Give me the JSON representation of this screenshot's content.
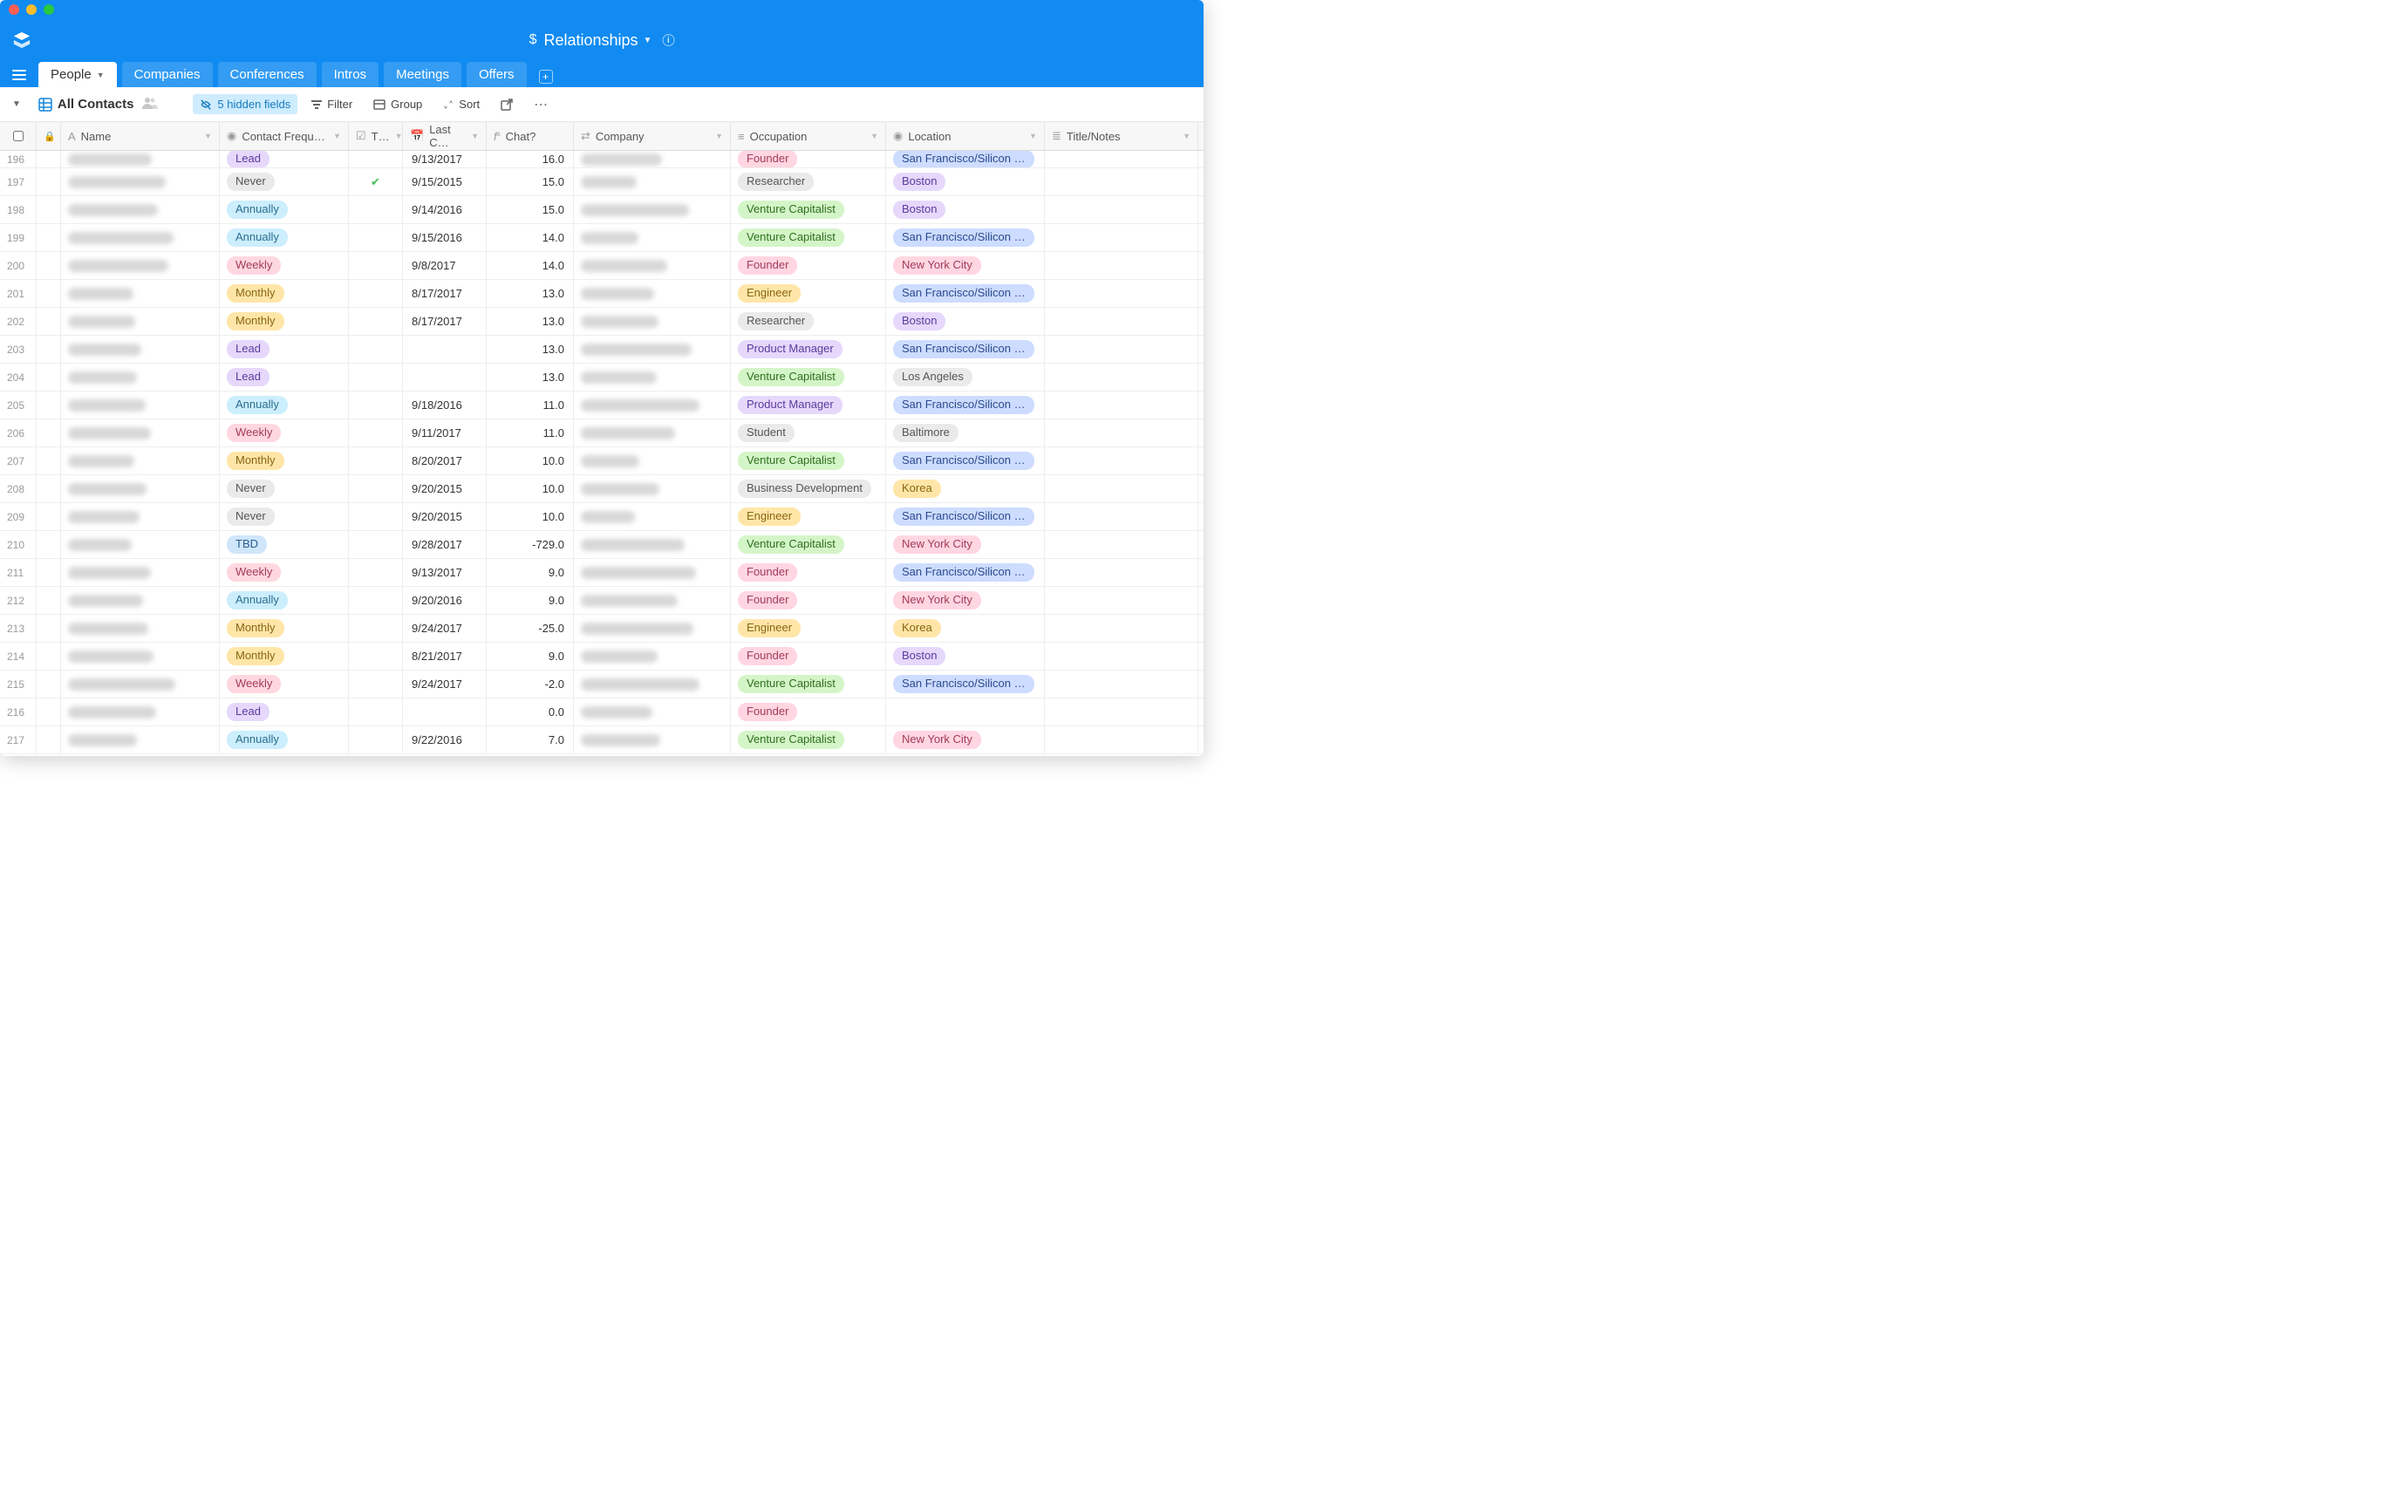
{
  "header": {
    "base_name": "Relationships"
  },
  "tabs": {
    "items": [
      {
        "label": "People",
        "active": true,
        "has_dropdown": true
      },
      {
        "label": "Companies",
        "active": false
      },
      {
        "label": "Conferences",
        "active": false
      },
      {
        "label": "Intros",
        "active": false
      },
      {
        "label": "Meetings",
        "active": false
      },
      {
        "label": "Offers",
        "active": false
      }
    ]
  },
  "viewbar": {
    "view_name": "All Contacts",
    "hidden_fields": "5 hidden fields",
    "filter": "Filter",
    "group": "Group",
    "sort": "Sort"
  },
  "columns": {
    "name": "Name",
    "contact_frequency": "Contact Frequ…",
    "t": "T…",
    "last_c": "Last C…",
    "chat": "Chat?",
    "company": "Company",
    "occupation": "Occupation",
    "location": "Location",
    "title_notes": "Title/Notes"
  },
  "pill_styles": {
    "freq": {
      "Lead": "pill-lead",
      "Never": "pill-never",
      "Annually": "pill-annually",
      "Weekly": "pill-weekly",
      "Monthly": "pill-monthly",
      "TBD": "pill-tbd"
    },
    "occ": {
      "Founder": "pill-founder",
      "Researcher": "pill-researcher",
      "Venture Capitalist": "pill-vc",
      "Engineer": "pill-engineer",
      "Product Manager": "pill-pm",
      "Student": "pill-student",
      "Business Development": "pill-bizdev"
    },
    "loc": {
      "San Francisco/Silicon …": "pill-sf",
      "Boston": "pill-boston",
      "New York City": "pill-nyc",
      "Los Angeles": "pill-la",
      "Baltimore": "pill-baltimore",
      "Korea": "pill-korea"
    }
  },
  "rows": [
    {
      "n": 196,
      "freq": "Lead",
      "t": false,
      "last": "9/13/2017",
      "chat": "16.0",
      "occ": "Founder",
      "loc": "San Francisco/Silicon …"
    },
    {
      "n": 197,
      "freq": "Never",
      "t": true,
      "last": "9/15/2015",
      "chat": "15.0",
      "occ": "Researcher",
      "loc": "Boston"
    },
    {
      "n": 198,
      "freq": "Annually",
      "t": false,
      "last": "9/14/2016",
      "chat": "15.0",
      "occ": "Venture Capitalist",
      "loc": "Boston"
    },
    {
      "n": 199,
      "freq": "Annually",
      "t": false,
      "last": "9/15/2016",
      "chat": "14.0",
      "occ": "Venture Capitalist",
      "loc": "San Francisco/Silicon …"
    },
    {
      "n": 200,
      "freq": "Weekly",
      "t": false,
      "last": "9/8/2017",
      "chat": "14.0",
      "occ": "Founder",
      "loc": "New York City"
    },
    {
      "n": 201,
      "freq": "Monthly",
      "t": false,
      "last": "8/17/2017",
      "chat": "13.0",
      "occ": "Engineer",
      "loc": "San Francisco/Silicon …"
    },
    {
      "n": 202,
      "freq": "Monthly",
      "t": false,
      "last": "8/17/2017",
      "chat": "13.0",
      "occ": "Researcher",
      "loc": "Boston"
    },
    {
      "n": 203,
      "freq": "Lead",
      "t": false,
      "last": "",
      "chat": "13.0",
      "occ": "Product Manager",
      "loc": "San Francisco/Silicon …"
    },
    {
      "n": 204,
      "freq": "Lead",
      "t": false,
      "last": "",
      "chat": "13.0",
      "occ": "Venture Capitalist",
      "loc": "Los Angeles"
    },
    {
      "n": 205,
      "freq": "Annually",
      "t": false,
      "last": "9/18/2016",
      "chat": "11.0",
      "occ": "Product Manager",
      "loc": "San Francisco/Silicon …"
    },
    {
      "n": 206,
      "freq": "Weekly",
      "t": false,
      "last": "9/11/2017",
      "chat": "11.0",
      "occ": "Student",
      "loc": "Baltimore"
    },
    {
      "n": 207,
      "freq": "Monthly",
      "t": false,
      "last": "8/20/2017",
      "chat": "10.0",
      "occ": "Venture Capitalist",
      "loc": "San Francisco/Silicon …"
    },
    {
      "n": 208,
      "freq": "Never",
      "t": false,
      "last": "9/20/2015",
      "chat": "10.0",
      "occ": "Business Development",
      "loc": "Korea"
    },
    {
      "n": 209,
      "freq": "Never",
      "t": false,
      "last": "9/20/2015",
      "chat": "10.0",
      "occ": "Engineer",
      "loc": "San Francisco/Silicon …"
    },
    {
      "n": 210,
      "freq": "TBD",
      "t": false,
      "last": "9/28/2017",
      "chat": "-729.0",
      "occ": "Venture Capitalist",
      "loc": "New York City"
    },
    {
      "n": 211,
      "freq": "Weekly",
      "t": false,
      "last": "9/13/2017",
      "chat": "9.0",
      "occ": "Founder",
      "loc": "San Francisco/Silicon …"
    },
    {
      "n": 212,
      "freq": "Annually",
      "t": false,
      "last": "9/20/2016",
      "chat": "9.0",
      "occ": "Founder",
      "loc": "New York City"
    },
    {
      "n": 213,
      "freq": "Monthly",
      "t": false,
      "last": "9/24/2017",
      "chat": "-25.0",
      "occ": "Engineer",
      "loc": "Korea"
    },
    {
      "n": 214,
      "freq": "Monthly",
      "t": false,
      "last": "8/21/2017",
      "chat": "9.0",
      "occ": "Founder",
      "loc": "Boston"
    },
    {
      "n": 215,
      "freq": "Weekly",
      "t": false,
      "last": "9/24/2017",
      "chat": "-2.0",
      "occ": "Venture Capitalist",
      "loc": "San Francisco/Silicon …"
    },
    {
      "n": 216,
      "freq": "Lead",
      "t": false,
      "last": "",
      "chat": "0.0",
      "occ": "Founder",
      "loc": ""
    },
    {
      "n": 217,
      "freq": "Annually",
      "t": false,
      "last": "9/22/2016",
      "chat": "7.0",
      "occ": "Venture Capitalist",
      "loc": "New York City"
    }
  ]
}
